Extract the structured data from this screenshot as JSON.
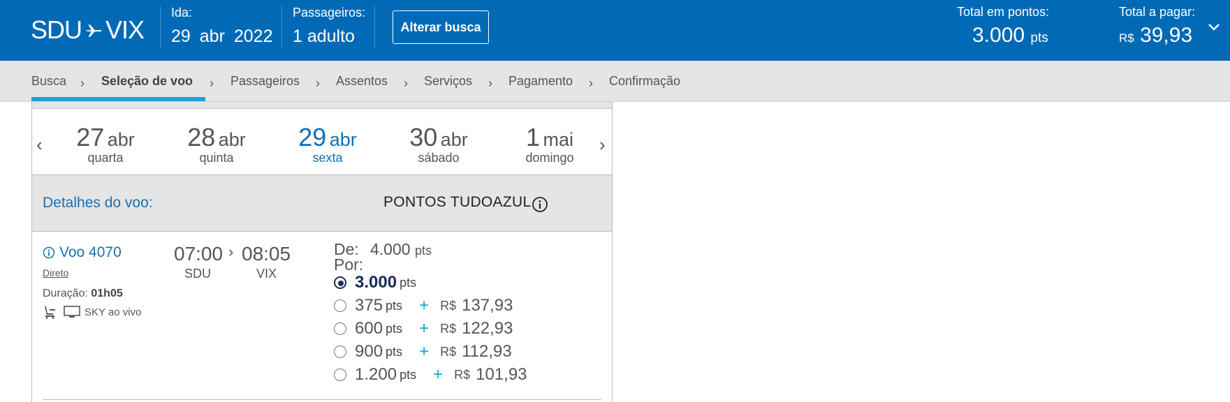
{
  "header": {
    "route_from": "SDU",
    "route_to": "VIX",
    "ida_label": "Ida:",
    "ida_day": "29",
    "ida_month": "abr",
    "ida_year": "2022",
    "pass_label": "Passageiros:",
    "pass_value": "1 adulto",
    "alter_button": "Alterar busca",
    "total_points_label": "Total em pontos:",
    "total_points_value": "3.000",
    "total_points_unit": "pts",
    "total_pay_label": "Total a pagar:",
    "total_pay_currency": "R$",
    "total_pay_value": "39,93",
    "bg_color": "#006ab7"
  },
  "breadcrumb": {
    "items": [
      {
        "label": "Busca"
      },
      {
        "label": "Seleção de voo"
      },
      {
        "label": "Passageiros"
      },
      {
        "label": "Assentos"
      },
      {
        "label": "Serviços"
      },
      {
        "label": "Pagamento"
      },
      {
        "label": "Confirmação"
      }
    ],
    "active_index": 1,
    "accent": "#19a4d8"
  },
  "dates": [
    {
      "day": "27",
      "month": "abr",
      "weekday": "quarta"
    },
    {
      "day": "28",
      "month": "abr",
      "weekday": "quinta"
    },
    {
      "day": "29",
      "month": "abr",
      "weekday": "sexta"
    },
    {
      "day": "30",
      "month": "abr",
      "weekday": "sábado"
    },
    {
      "day": "1",
      "month": "mai",
      "weekday": "domingo"
    }
  ],
  "selected_date_index": 2,
  "details": {
    "title": "Detalhes do voo:",
    "points_title": "PONTOS TUDOAZUL"
  },
  "flight": {
    "number": "Voo 4070",
    "type": "Direto",
    "duration_label": "Duração:",
    "duration_value": "01h05",
    "entertainment": "SKY ao vivo",
    "depart_time": "07:00",
    "arrive_time": "08:05",
    "depart_airport": "SDU",
    "arrive_airport": "VIX",
    "de_label": "De:",
    "de_value": "4.000",
    "de_unit": "pts",
    "por_label": "Por:"
  },
  "options": [
    {
      "points": "3.000",
      "unit": "pts",
      "plus": "",
      "currency": "",
      "money": "",
      "selected": true
    },
    {
      "points": "375",
      "unit": "pts",
      "plus": "+",
      "currency": "R$",
      "money": "137,93",
      "selected": false
    },
    {
      "points": "600",
      "unit": "pts",
      "plus": "+",
      "currency": "R$",
      "money": "122,93",
      "selected": false
    },
    {
      "points": "900",
      "unit": "pts",
      "plus": "+",
      "currency": "R$",
      "money": "112,93",
      "selected": false
    },
    {
      "points": "1.200",
      "unit": "pts",
      "plus": "+",
      "currency": "R$",
      "money": "101,93",
      "selected": false
    }
  ]
}
